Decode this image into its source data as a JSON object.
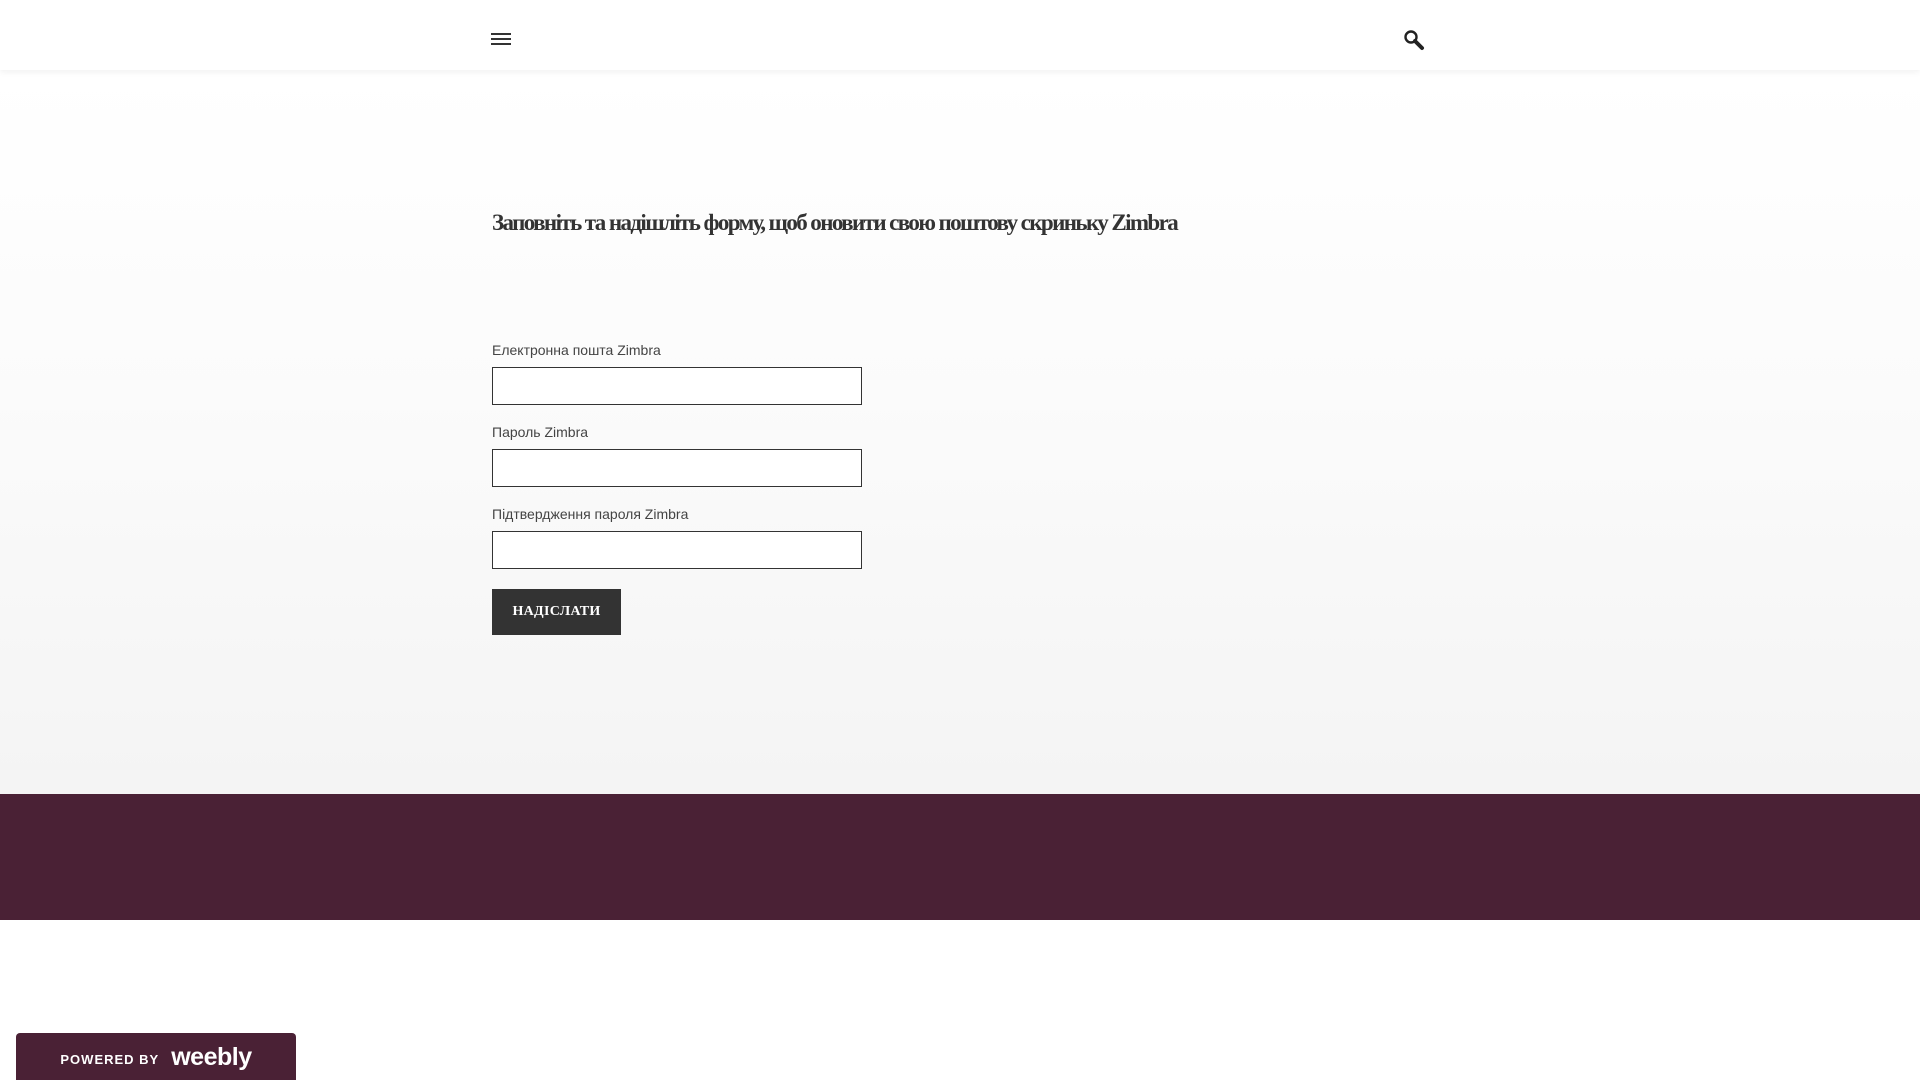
{
  "header": {
    "menu_icon": "hamburger-menu-icon",
    "search_icon": "search-icon"
  },
  "form": {
    "title": "Заповніть та надішліть форму, щоб оновити свою поштову скриньку Zimbra",
    "email_label": "Електронна пошта Zimbra",
    "email_value": "",
    "password_label": "Пароль Zimbra",
    "password_value": "",
    "confirm_label": "Підтвердження пароля Zimbra",
    "confirm_value": "",
    "submit_label": "НАДІСЛАТИ"
  },
  "badge": {
    "powered_by": "POWERED BY",
    "brand": "weebly"
  },
  "colors": {
    "footer_band": "#4a2135",
    "button": "#333333",
    "text": "#333333"
  }
}
